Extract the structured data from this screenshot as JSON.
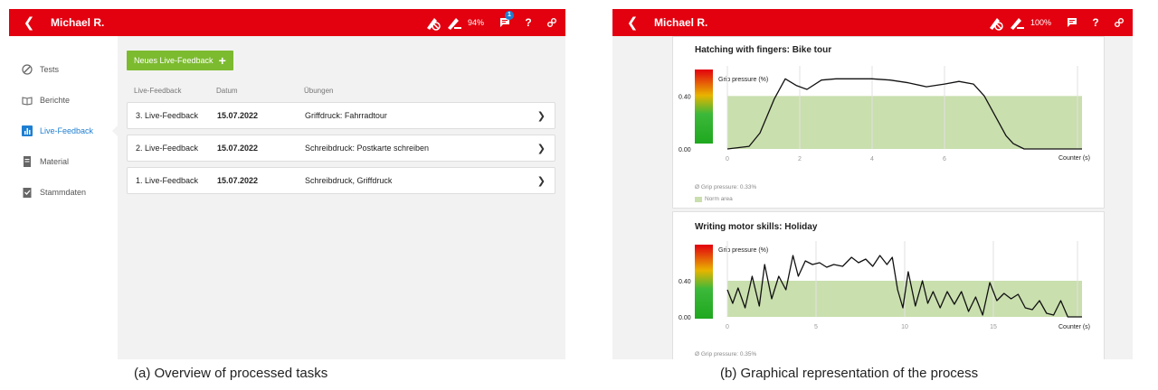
{
  "colors": {
    "topbar": "#e3000f",
    "active": "#1e7fd2",
    "green_button": "#7cbb2f",
    "norm_area": "#c9dfae"
  },
  "panel_a": {
    "user_name": "Michael R.",
    "battery": "94%",
    "notification_count": "1",
    "help": "?",
    "sidebar": [
      {
        "label": "Tests",
        "icon": "pen-nib-icon"
      },
      {
        "label": "Berichte",
        "icon": "book-icon"
      },
      {
        "label": "Live-Feedback",
        "icon": "bar-chart-icon",
        "active": true
      },
      {
        "label": "Material",
        "icon": "document-icon"
      },
      {
        "label": "Stammdaten",
        "icon": "clipboard-icon"
      }
    ],
    "new_button": "Neues Live-Feedback",
    "columns": [
      "Live-Feedback",
      "Datum",
      "Übungen"
    ],
    "rows": [
      {
        "label": "3.  Live-Feedback",
        "date": "15.07.2022",
        "exercise": "Griffdruck: Fahrradtour"
      },
      {
        "label": "2.  Live-Feedback",
        "date": "15.07.2022",
        "exercise": "Schreibdruck: Postkarte schreiben"
      },
      {
        "label": "1.  Live-Feedback",
        "date": "15.07.2022",
        "exercise": "Schreibdruck, Griffdruck"
      }
    ]
  },
  "panel_b": {
    "user_name": "Michael R.",
    "battery": "100%",
    "help": "?",
    "chart1": {
      "title": "Hatching with fingers: Bike tour",
      "ylabel": "Grip pressure (%)",
      "xlabel": "Counter (s)",
      "yticks": [
        "0.40",
        "0.00"
      ],
      "xticks": [
        "0",
        "2",
        "4",
        "6"
      ],
      "average": "Ø Grip pressure: 0.33%",
      "legend": "Norm area"
    },
    "chart2": {
      "title": "Writing motor skills: Holiday",
      "ylabel": "Grip pressure (%)",
      "xlabel": "Counter (s)",
      "yticks": [
        "0.40",
        "0.00"
      ],
      "xticks": [
        "0",
        "5",
        "10",
        "15"
      ],
      "average": "Ø Grip pressure: 0.35%"
    }
  },
  "captions": {
    "a": "(a) Overview of processed tasks",
    "b": "(b) Graphical representation of the process"
  },
  "chart_data": [
    {
      "type": "line",
      "title": "Hatching with fingers: Bike tour",
      "ylabel": "Grip pressure (%)",
      "xlabel": "Counter (s)",
      "xlim": [
        0,
        9.8
      ],
      "ylim": [
        0,
        0.6
      ],
      "norm_range": [
        0,
        0.4
      ],
      "series": [
        {
          "x": [
            0,
            0.6,
            0.9,
            1.3,
            1.6,
            1.9,
            2.2,
            2.6,
            3.0,
            3.5,
            4.0,
            4.5,
            5.0,
            5.5,
            6.0,
            6.4,
            6.8,
            7.1,
            7.4,
            7.7,
            7.9,
            8.2,
            8.5,
            9.8
          ],
          "y": [
            0.0,
            0.02,
            0.12,
            0.38,
            0.53,
            0.48,
            0.45,
            0.52,
            0.53,
            0.53,
            0.53,
            0.52,
            0.5,
            0.47,
            0.49,
            0.51,
            0.49,
            0.4,
            0.25,
            0.1,
            0.04,
            0.0,
            0.0,
            0.0
          ]
        }
      ]
    },
    {
      "type": "line",
      "title": "Writing motor skills: Holiday",
      "ylabel": "Grip pressure (%)",
      "xlabel": "Counter (s)",
      "xlim": [
        0,
        20
      ],
      "ylim": [
        0,
        0.8
      ],
      "norm_range": [
        0,
        0.4
      ],
      "series": [
        {
          "x": [
            0,
            0.3,
            0.6,
            1.0,
            1.4,
            1.8,
            2.1,
            2.5,
            2.9,
            3.3,
            3.7,
            4.0,
            4.4,
            4.8,
            5.2,
            5.6,
            6.0,
            6.5,
            7.0,
            7.4,
            7.8,
            8.2,
            8.6,
            9.0,
            9.3,
            9.6,
            9.9,
            10.2,
            10.6,
            11.0,
            11.3,
            11.6,
            12.0,
            12.4,
            12.8,
            13.2,
            13.6,
            14.0,
            14.4,
            14.8,
            15.2,
            15.6,
            16.0,
            16.4,
            16.8,
            17.2,
            17.6,
            18.0,
            18.4,
            18.8,
            19.2,
            20
          ],
          "y": [
            0.3,
            0.15,
            0.32,
            0.1,
            0.45,
            0.12,
            0.58,
            0.2,
            0.45,
            0.3,
            0.68,
            0.45,
            0.62,
            0.58,
            0.6,
            0.55,
            0.58,
            0.56,
            0.66,
            0.6,
            0.64,
            0.56,
            0.68,
            0.58,
            0.66,
            0.3,
            0.1,
            0.5,
            0.12,
            0.4,
            0.15,
            0.28,
            0.1,
            0.28,
            0.14,
            0.28,
            0.06,
            0.22,
            0.02,
            0.38,
            0.18,
            0.26,
            0.2,
            0.25,
            0.1,
            0.08,
            0.18,
            0.04,
            0.02,
            0.18,
            0.0,
            0.0
          ]
        }
      ]
    }
  ]
}
